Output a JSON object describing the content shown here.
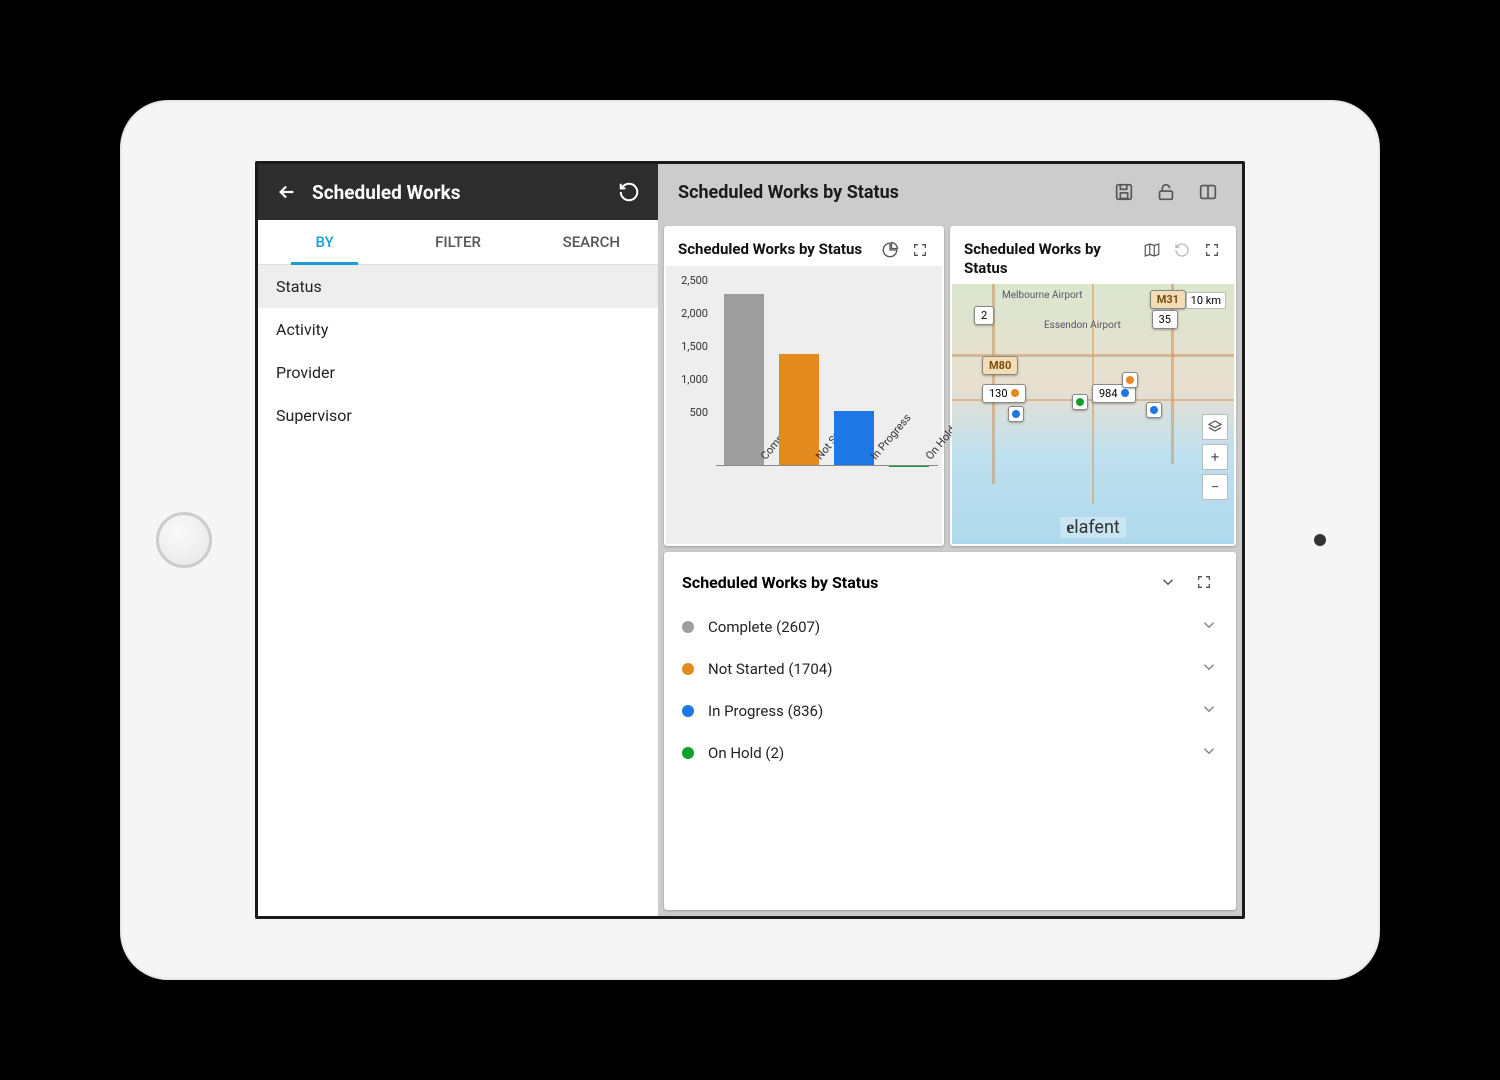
{
  "left": {
    "title": "Scheduled Works",
    "tabs": [
      "BY",
      "FILTER",
      "SEARCH"
    ],
    "active_tab": 0,
    "options": [
      "Status",
      "Activity",
      "Provider",
      "Supervisor"
    ],
    "selected_option": 0
  },
  "right": {
    "title": "Scheduled Works by Status"
  },
  "chart_card": {
    "title": "Scheduled Works by Status"
  },
  "map_card": {
    "title": "Scheduled Works by Status",
    "scale_label": "10 km",
    "brand": "elafent",
    "markers": [
      "2",
      "35",
      "130",
      "984"
    ],
    "road_labels": [
      "M80",
      "M31"
    ],
    "place_labels": [
      "Melbourne Airport",
      "Essendon Airport"
    ]
  },
  "list_card": {
    "title": "Scheduled Works by Status",
    "items": [
      {
        "label": "Complete (2607)",
        "color": "#9e9e9e"
      },
      {
        "label": "Not Started (1704)",
        "color": "#e38b1e"
      },
      {
        "label": "In Progress (836)",
        "color": "#1d78e6"
      },
      {
        "label": "On Hold (2)",
        "color": "#11a02a"
      }
    ]
  },
  "chart_data": {
    "type": "bar",
    "title": "Scheduled Works by Status",
    "categories": [
      "Complete",
      "Not Started",
      "In Progress",
      "On Hold"
    ],
    "values": [
      2607,
      1704,
      836,
      2
    ],
    "colors": [
      "#9e9e9e",
      "#e38b1e",
      "#1d78e6",
      "#11a02a"
    ],
    "yticks": [
      500,
      1000,
      1500,
      2000,
      2500
    ],
    "ylim": [
      0,
      2607
    ],
    "xlabel": "",
    "ylabel": ""
  }
}
